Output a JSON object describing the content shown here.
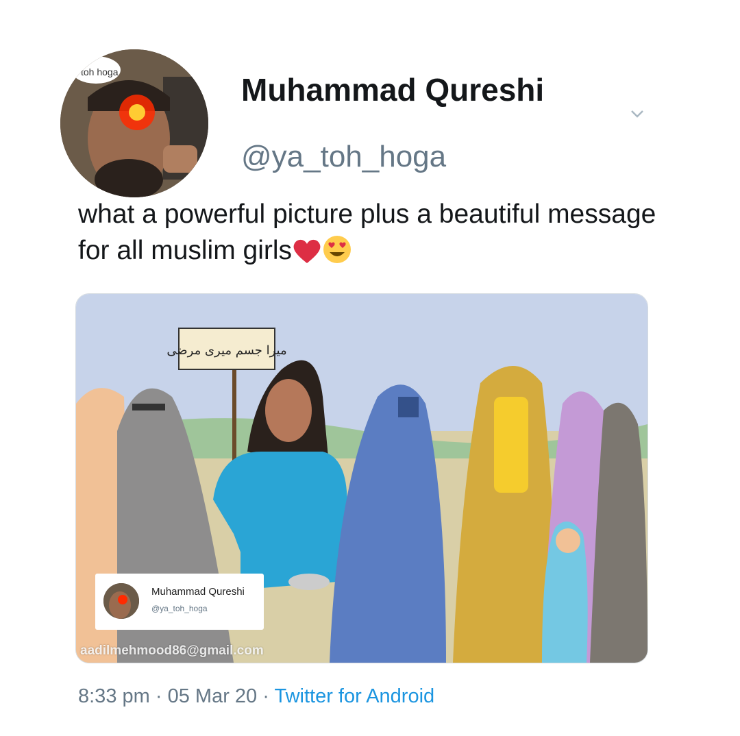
{
  "tweet": {
    "author_name": "Muhammad Qureshi",
    "author_handle": "@ya_toh_hoga",
    "text": "what a powerful picture plus a beautiful message for all muslim girls",
    "emojis": [
      "red-heart-emoji",
      "heart-eyes-emoji"
    ],
    "time": "8:33 pm",
    "separator": "·",
    "date": "05 Mar 20",
    "source": "Twitter for Android",
    "source_color": "#1b95e0",
    "menu_icon": "chevron-down-icon"
  },
  "avatar": {
    "sticker_text": "toh hoga"
  },
  "media": {
    "sign_text": "میرا جسم میری مرضی",
    "watermark": {
      "name": "Muhammad Qureshi",
      "handle": "@ya_toh_hoga",
      "email": "aadilmehmood86@gmail.com"
    }
  }
}
